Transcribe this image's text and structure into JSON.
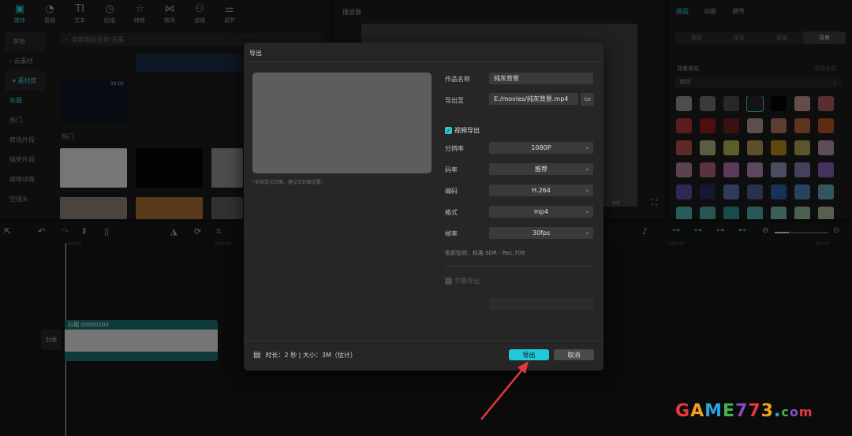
{
  "toolbar": {
    "items": [
      {
        "label": "媒体",
        "icon": "media-icon"
      },
      {
        "label": "音频",
        "icon": "audio-icon"
      },
      {
        "label": "文本",
        "icon": "text-icon"
      },
      {
        "label": "贴纸",
        "icon": "sticker-icon"
      },
      {
        "label": "特效",
        "icon": "effects-icon"
      },
      {
        "label": "转场",
        "icon": "transition-icon"
      },
      {
        "label": "滤镜",
        "icon": "filter-icon"
      },
      {
        "label": "调节",
        "icon": "adjust-icon"
      }
    ]
  },
  "sidebar": {
    "items": [
      {
        "label": "本地"
      },
      {
        "label": "› 云素材"
      },
      {
        "label": "▾ 素材库"
      },
      {
        "label": "收藏"
      },
      {
        "label": "热门"
      },
      {
        "label": "转场片段"
      },
      {
        "label": "搞笑片段"
      },
      {
        "label": "故障动画"
      },
      {
        "label": "空镜头"
      }
    ]
  },
  "media": {
    "search_placeholder": "搜索视频场景/元素",
    "section_hot": "热门",
    "thumb_duration": "00:03"
  },
  "player": {
    "title": "播放器"
  },
  "right_panel": {
    "tabs": [
      "画面",
      "动画",
      "调节"
    ],
    "subtabs": [
      "基础",
      "抠像",
      "蒙版",
      "背景"
    ],
    "bg_fill_label": "背景填充",
    "apply_all": "应用全部",
    "fill_type": "颜色",
    "swatches": [
      "#8a8a8a",
      "#6a6a6a",
      "#4a4a4a",
      "#262626",
      "#050505",
      "#b38a8a",
      "#a65656",
      "#a83333",
      "#8c1a1a",
      "#6b1f1f",
      "#a8918c",
      "#a8705c",
      "#a8603a",
      "#a8521e",
      "#a84b4b",
      "#a8a878",
      "#a8a850",
      "#a89150",
      "#a8841e",
      "#a89a50",
      "#a88ca0",
      "#a87890",
      "#a85a70",
      "#a86aa0",
      "#a880b0",
      "#8c8cb0",
      "#7878a8",
      "#7a5ab0",
      "#5a4aa0",
      "#2a2a5a",
      "#5a6aa0",
      "#4a5a90",
      "#2a5aa0",
      "#4a7ab0",
      "#5aa0b0",
      "#4aa8a8",
      "#4a9a9a",
      "#2a8a8a",
      "#4aa0a0",
      "#6ab0a0",
      "#8ab090",
      "#a0b08a"
    ],
    "accent": "#2ec6d4"
  },
  "timeline": {
    "ruler": [
      "00:00",
      "100:00",
      "100:00",
      "00:00"
    ],
    "clip_label": "石榴  00000200",
    "cover_label": "封面"
  },
  "dialog": {
    "title": "导出",
    "cover_hint": "*未自定义封面，建议去封面设置。",
    "fields": {
      "name_label": "作品名称",
      "name_value": "纯灰背景",
      "export_to_label": "导出至",
      "export_to_value": "E:/movies/纯灰背景.mp4",
      "video_export_label": "视频导出",
      "resolution_label": "分辨率",
      "resolution_value": "1080P",
      "bitrate_label": "码率",
      "bitrate_value": "推荐",
      "codec_label": "编码",
      "codec_value": "H.264",
      "format_label": "格式",
      "format_value": "mp4",
      "fps_label": "帧率",
      "fps_value": "30fps",
      "color_space": "色彩空间：标准 SDR - Rec.709",
      "subtitle_export_label": "字幕导出"
    },
    "footer_info": "时长：2 秒 | 大小：3M（估计）",
    "export_button": "导出",
    "cancel_button": "取消"
  },
  "watermark": {
    "text": "GAME773.com",
    "colors": [
      "#e83a3a",
      "#f2a21a",
      "#27a6e0",
      "#44b34a",
      "#8c4ac6"
    ]
  }
}
